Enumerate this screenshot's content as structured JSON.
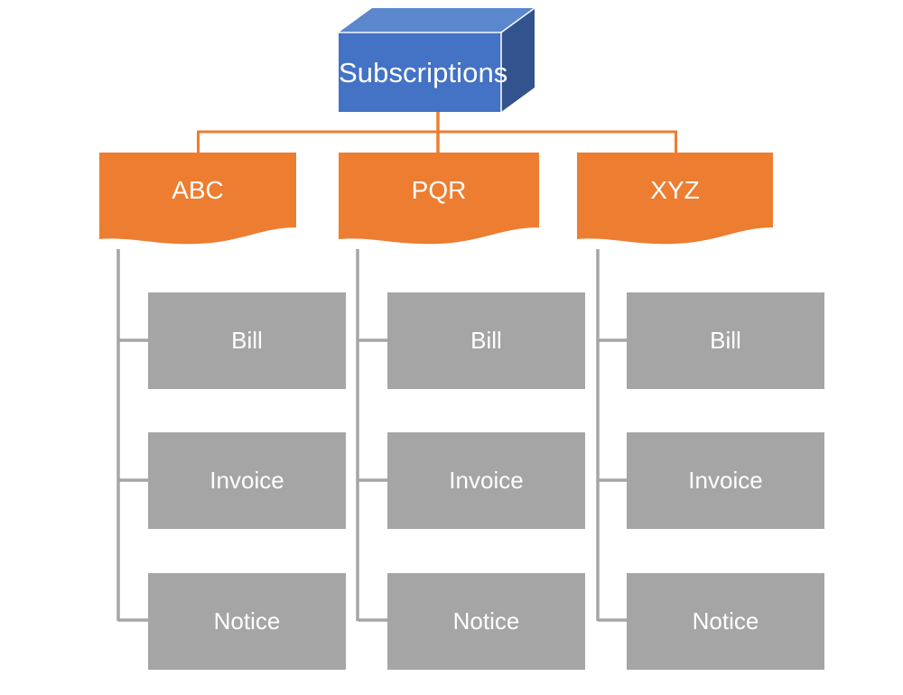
{
  "diagram": {
    "type": "organization-hierarchy",
    "title_node": {
      "label": "Subscriptions",
      "shape": "3d-box",
      "fill": "#4472C4",
      "top_face": "#5B87CD",
      "side_face": "#33538E",
      "text_color": "#FFFFFF"
    },
    "connector_colors": {
      "level1": "#ED7D31",
      "level2": "#A5A5A5"
    },
    "branches": [
      {
        "label": "ABC",
        "shape": "wave-banner",
        "fill": "#ED7D31",
        "text_color": "#FFFFFF",
        "children": [
          {
            "label": "Bill",
            "fill": "#A5A5A5",
            "text_color": "#FFFFFF"
          },
          {
            "label": "Invoice",
            "fill": "#A5A5A5",
            "text_color": "#FFFFFF"
          },
          {
            "label": "Notice",
            "fill": "#A5A5A5",
            "text_color": "#FFFFFF"
          }
        ]
      },
      {
        "label": "PQR",
        "shape": "wave-banner",
        "fill": "#ED7D31",
        "text_color": "#FFFFFF",
        "children": [
          {
            "label": "Bill",
            "fill": "#A5A5A5",
            "text_color": "#FFFFFF"
          },
          {
            "label": "Invoice",
            "fill": "#A5A5A5",
            "text_color": "#FFFFFF"
          },
          {
            "label": "Notice",
            "fill": "#A5A5A5",
            "text_color": "#FFFFFF"
          }
        ]
      },
      {
        "label": "XYZ",
        "shape": "wave-banner",
        "fill": "#ED7D31",
        "text_color": "#FFFFFF",
        "children": [
          {
            "label": "Bill",
            "fill": "#A5A5A5",
            "text_color": "#FFFFFF"
          },
          {
            "label": "Invoice",
            "fill": "#A5A5A5",
            "text_color": "#FFFFFF"
          },
          {
            "label": "Notice",
            "fill": "#A5A5A5",
            "text_color": "#FFFFFF"
          }
        ]
      }
    ]
  }
}
